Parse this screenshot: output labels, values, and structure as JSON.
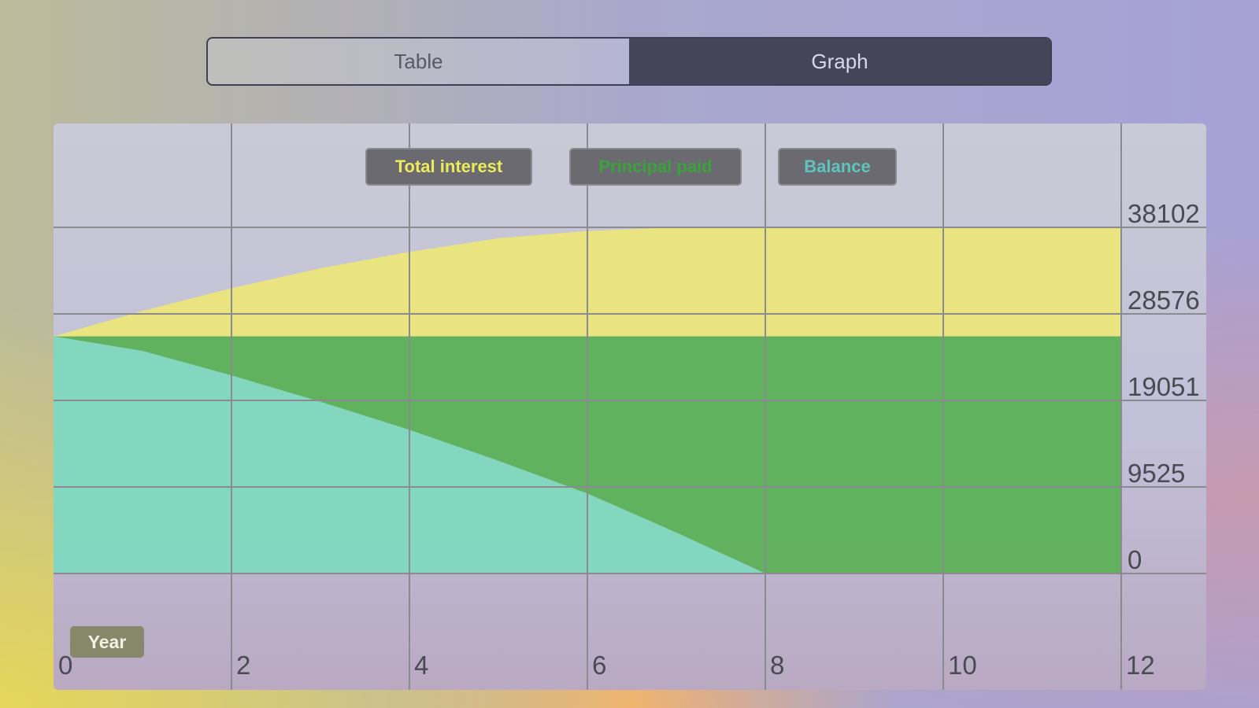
{
  "tabs": [
    {
      "label": "Table",
      "active": false
    },
    {
      "label": "Graph",
      "active": true
    }
  ],
  "legend": [
    {
      "label": "Total interest",
      "color": "#ecec5a"
    },
    {
      "label": "Principal paid",
      "color": "#3aa33a"
    },
    {
      "label": "Balance",
      "color": "#5fc4c0"
    }
  ],
  "colors": {
    "interest_fill": "#ebe67a",
    "principal_fill": "#5cb158",
    "balance_fill": "#80d8be",
    "grid": "#8a8a90"
  },
  "chart_data": {
    "type": "area",
    "xlabel": "Year",
    "xlim": [
      0,
      12
    ],
    "ylim": [
      -9525,
      38102
    ],
    "x_ticks": [
      0,
      2,
      4,
      6,
      8,
      10,
      12
    ],
    "y_ticks": [
      0,
      9525,
      19051,
      28576,
      38102
    ],
    "y_tick_labels": [
      "0",
      "9525",
      "19051",
      "28576",
      "38102"
    ],
    "legend_position": "top",
    "grid": true,
    "series": [
      {
        "name": "Balance",
        "x": [
          0,
          1,
          2,
          3,
          4,
          5,
          6,
          7,
          8
        ],
        "values": [
          26100,
          24500,
          21800,
          18900,
          15800,
          12400,
          8800,
          4500,
          0
        ]
      },
      {
        "name": "Principal paid",
        "x": [
          0,
          1,
          2,
          3,
          4,
          5,
          6,
          7,
          8,
          12
        ],
        "values": [
          26100,
          26100,
          26100,
          26100,
          26100,
          26100,
          26100,
          26100,
          26100,
          26100
        ]
      },
      {
        "name": "Total interest",
        "x": [
          0,
          1,
          2,
          3,
          4,
          5,
          6,
          7,
          8,
          12
        ],
        "values": [
          26100,
          28900,
          31400,
          33600,
          35400,
          36900,
          37700,
          38102,
          38102,
          38102
        ]
      }
    ]
  }
}
